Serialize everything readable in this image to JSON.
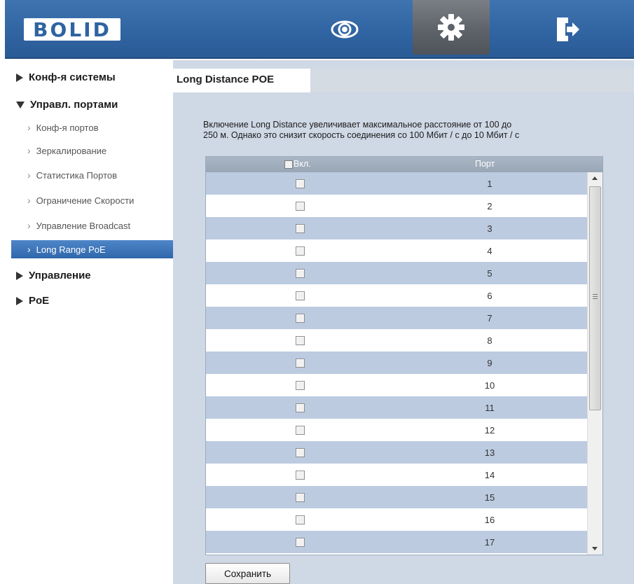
{
  "header": {
    "logo": "BOLID",
    "nav_icons": [
      "eye-icon",
      "gear-icon",
      "logout-icon"
    ],
    "active_nav": "gear-icon",
    "accent_color": "#2f63a1"
  },
  "sidebar": {
    "sections": [
      {
        "label": "Конф-я системы",
        "expanded": false
      },
      {
        "label": "Управл. портами",
        "expanded": true
      },
      {
        "label": "Управление",
        "expanded": false
      },
      {
        "label": "PoE",
        "expanded": false
      }
    ],
    "port_items": [
      {
        "label": "Конф-я портов"
      },
      {
        "label": "Зеркалирование"
      },
      {
        "label": "Статистика Портов"
      },
      {
        "label": "Ограничение Скорости"
      },
      {
        "label": "Управление Broadcast"
      },
      {
        "label": "Long Range PoE",
        "active": true
      }
    ]
  },
  "main": {
    "tab_title": "Long Distance POE",
    "description_line1": "Включение Long Distance увеличивает максимальное расстояние от 100 до",
    "description_line2": "250 м. Однако это снизит скорость соединения со 100 Мбит / с до 10 Мбит / с",
    "table": {
      "col_enable": "Вкл.",
      "col_port": "Порт",
      "header_checked": false,
      "rows": [
        {
          "port": "1",
          "enabled": false
        },
        {
          "port": "2",
          "enabled": false
        },
        {
          "port": "3",
          "enabled": false
        },
        {
          "port": "4",
          "enabled": false
        },
        {
          "port": "5",
          "enabled": false
        },
        {
          "port": "6",
          "enabled": false
        },
        {
          "port": "7",
          "enabled": false
        },
        {
          "port": "8",
          "enabled": false
        },
        {
          "port": "9",
          "enabled": false
        },
        {
          "port": "10",
          "enabled": false
        },
        {
          "port": "11",
          "enabled": false
        },
        {
          "port": "12",
          "enabled": false
        },
        {
          "port": "13",
          "enabled": false
        },
        {
          "port": "14",
          "enabled": false
        },
        {
          "port": "15",
          "enabled": false
        },
        {
          "port": "16",
          "enabled": false
        },
        {
          "port": "17",
          "enabled": false
        }
      ]
    },
    "save_label": "Сохранить"
  }
}
